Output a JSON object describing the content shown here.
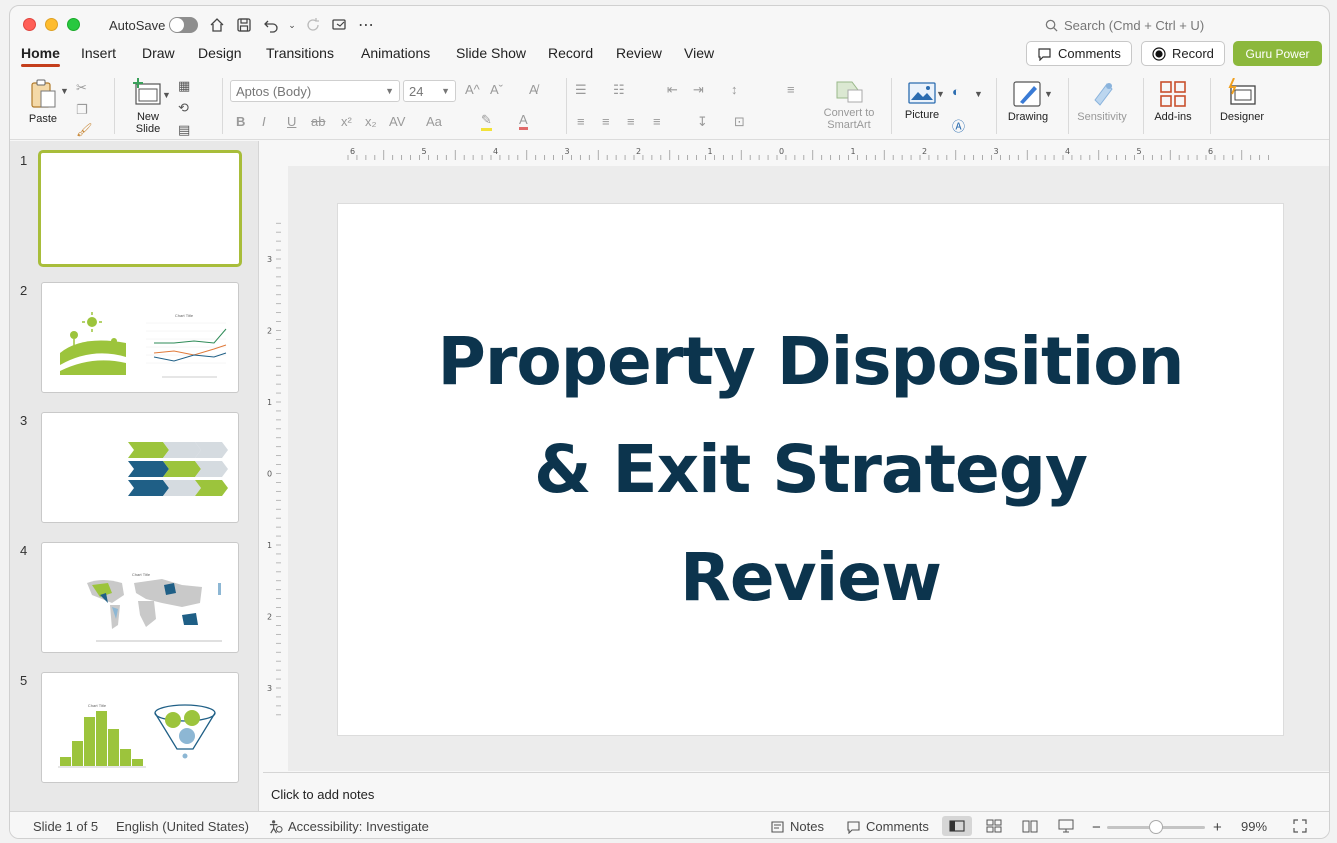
{
  "titlebar": {
    "autosave": "AutoSave",
    "search_placeholder": "Search (Cmd + Ctrl + U)"
  },
  "tabs": [
    "Home",
    "Insert",
    "Draw",
    "Design",
    "Transitions",
    "Animations",
    "Slide Show",
    "Record",
    "Review",
    "View"
  ],
  "actions": {
    "comments": "Comments",
    "record": "Record",
    "guru": "Guru Power"
  },
  "ribbon": {
    "paste": "Paste",
    "new_slide_1": "New",
    "new_slide_2": "Slide",
    "font_name": "Aptos (Body)",
    "font_size": "24",
    "convert_1": "Convert to",
    "convert_2": "SmartArt",
    "picture": "Picture",
    "drawing": "Drawing",
    "sensitivity": "Sensitivity",
    "addins": "Add-ins",
    "designer": "Designer"
  },
  "slides": [
    {
      "num": "1"
    },
    {
      "num": "2"
    },
    {
      "num": "3"
    },
    {
      "num": "4"
    },
    {
      "num": "5"
    }
  ],
  "thumb_texts": {
    "chart_title": "Chart Title"
  },
  "ruler_h": [
    "6",
    "5",
    "4",
    "3",
    "2",
    "1",
    "0",
    "1",
    "2",
    "3",
    "4",
    "5",
    "6"
  ],
  "ruler_v": [
    "3",
    "2",
    "1",
    "0",
    "1",
    "2",
    "3"
  ],
  "slide": {
    "title_line1": "Property Disposition",
    "title_line2": "& Exit Strategy",
    "title_line3": "Review"
  },
  "notes_placeholder": "Click to add notes",
  "status": {
    "slide_of": "Slide 1 of 5",
    "language": "English (United States)",
    "accessibility": "Accessibility: Investigate",
    "notes": "Notes",
    "comments": "Comments",
    "zoom": "99%",
    "zoom_level": 0.5
  },
  "colors": {
    "accent_green": "#8cb83c",
    "title_navy": "#0c344d",
    "tab_underline": "#c43e1c"
  }
}
